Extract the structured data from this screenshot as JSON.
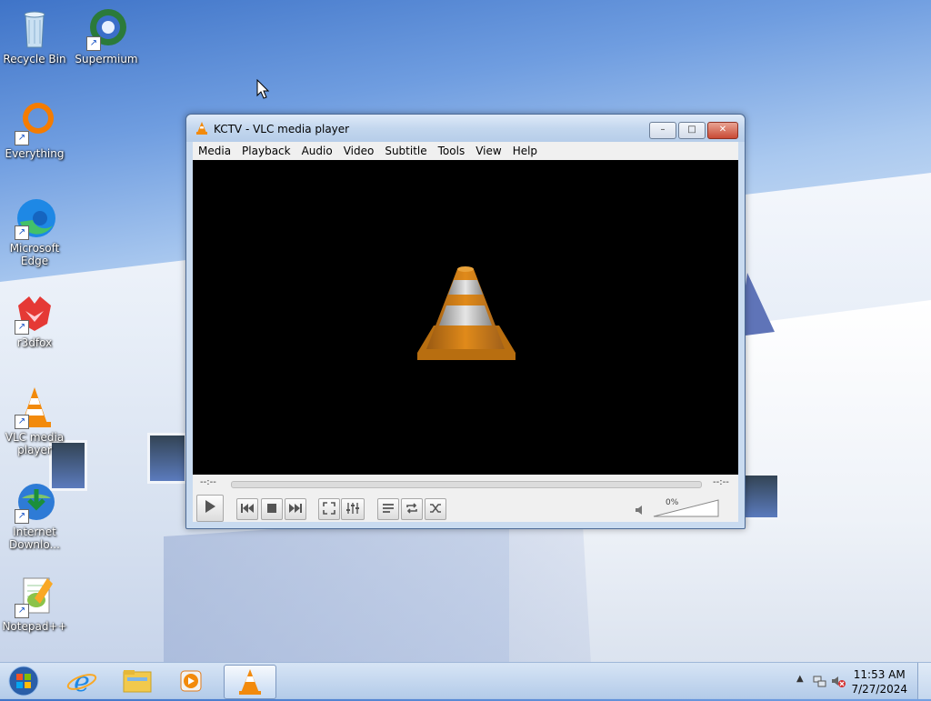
{
  "desktop": {
    "icons": [
      {
        "label": "Recycle Bin",
        "icon": "recycle-bin-icon"
      },
      {
        "label": "Supermium",
        "icon": "supermium-icon"
      },
      {
        "label": "Everything",
        "icon": "everything-icon"
      },
      {
        "label": "Microsoft Edge",
        "icon": "edge-icon"
      },
      {
        "label": "r3dfox",
        "icon": "r3dfox-icon"
      },
      {
        "label": "VLC media player",
        "icon": "vlc-icon"
      },
      {
        "label": "Internet Downlo...",
        "icon": "idm-icon"
      },
      {
        "label": "Notepad++",
        "icon": "notepadpp-icon"
      }
    ]
  },
  "window": {
    "title": "KCTV - VLC media player",
    "minimize": "–",
    "maximize": "□",
    "close": "✕",
    "menu": [
      "Media",
      "Playback",
      "Audio",
      "Video",
      "Subtitle",
      "Tools",
      "View",
      "Help"
    ],
    "elapsed": "--:--",
    "remaining": "--:--",
    "volume": "0%",
    "volume_level": 0
  },
  "taskbar": {
    "items": [
      "start",
      "internet-explorer",
      "file-explorer",
      "media-player",
      "vlc"
    ],
    "time": "11:53 AM",
    "date": "7/27/2024"
  },
  "colors": {
    "vlc_orange": "#f28a0c",
    "video_bg": "#000000",
    "close_red": "#c94a35"
  }
}
